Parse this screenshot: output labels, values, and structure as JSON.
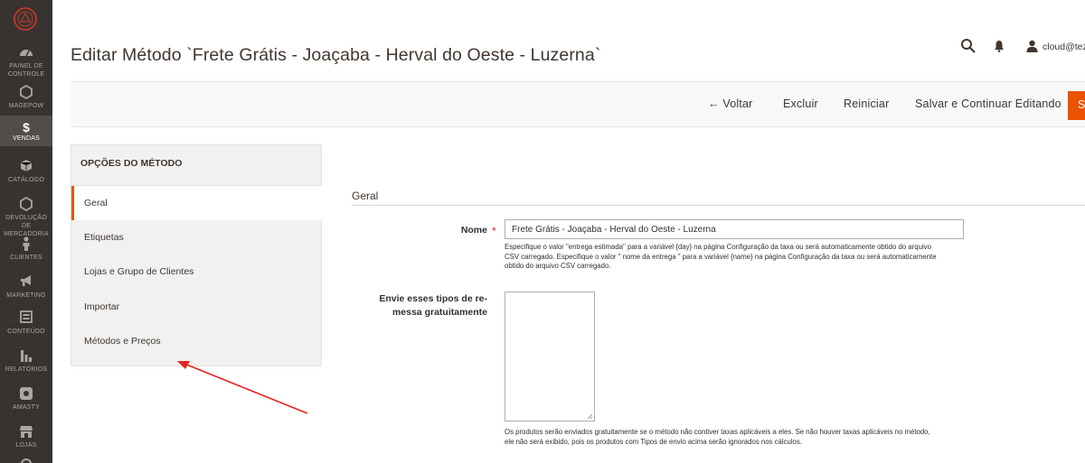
{
  "sidebar": {
    "items": [
      {
        "label": "PAINEL DE CONTROLE",
        "icon": "dashboard-icon"
      },
      {
        "label": "MAGEPOW",
        "icon": "hexagon-icon"
      },
      {
        "label": "VENDAS",
        "icon": "dollar-icon"
      },
      {
        "label": "CATÁLOGO",
        "icon": "box-icon"
      },
      {
        "label": "DEVOLUÇÃO DE MERCADORIA",
        "icon": "hexagon-icon"
      },
      {
        "label": "CLIENTES",
        "icon": "person-icon"
      },
      {
        "label": "MARKETING",
        "icon": "megaphone-icon"
      },
      {
        "label": "CONTEÚDO",
        "icon": "content-icon"
      },
      {
        "label": "RELATÓRIOS",
        "icon": "bar-chart-icon"
      },
      {
        "label": "AMASTY",
        "icon": "amasty-icon"
      },
      {
        "label": "LOJAS",
        "icon": "store-icon"
      }
    ],
    "active_item": "VENDAS",
    "accent": "#eb5202"
  },
  "header": {
    "title": "Editar Método `Frete Grátis - Joaçaba - Herval do Oeste - Luzerna`",
    "user_name": "cloud@tezu",
    "icons": [
      "search-icon",
      "bell-icon",
      "user-icon"
    ]
  },
  "actions": {
    "back": "← Voltar",
    "delete": "Excluir",
    "reset": "Reiniciar",
    "save_continue": "Salvar e Continuar Editando",
    "save": "S"
  },
  "tabs": {
    "title": "OPÇÕES DO MÉTODO",
    "items": [
      "Geral",
      "Etiquetas",
      "Lojas e Grupo de Clientes",
      "Importar",
      "Métodos e Preços"
    ],
    "active": "Geral"
  },
  "form": {
    "section_title": "Geral",
    "name_label": "Nome",
    "name_value": "Frete Grátis - Joaçaba - Herval do Oeste - Luzerna",
    "name_note_1": "Especifique o valor \"entrega estimada\" para a variável {day} na página Configuração da taxa ou será automaticamente obtido do arquivo",
    "name_note_2": "CSV carregado. Especifique o valor \" nome da entrega \" para a variável {name} na página Configuração da taxa ou será automaticamente",
    "name_note_3": "obtido do arquivo CSV carregado.",
    "free_types_label_1": "Envie esses tipos de re-",
    "free_types_label_2": "messa gratuitamente",
    "free_types_note_1": "Os produtos serão enviados gratuitamente se o método não contiver taxas aplicáveis a eles. Se não houver taxas aplicáveis no método,",
    "free_types_note_2": "ele não será exibido, pois os produtos com Tipos de envio acima serão ignorados nos cálculos."
  },
  "annotation_arrow_color": "#e8231f"
}
